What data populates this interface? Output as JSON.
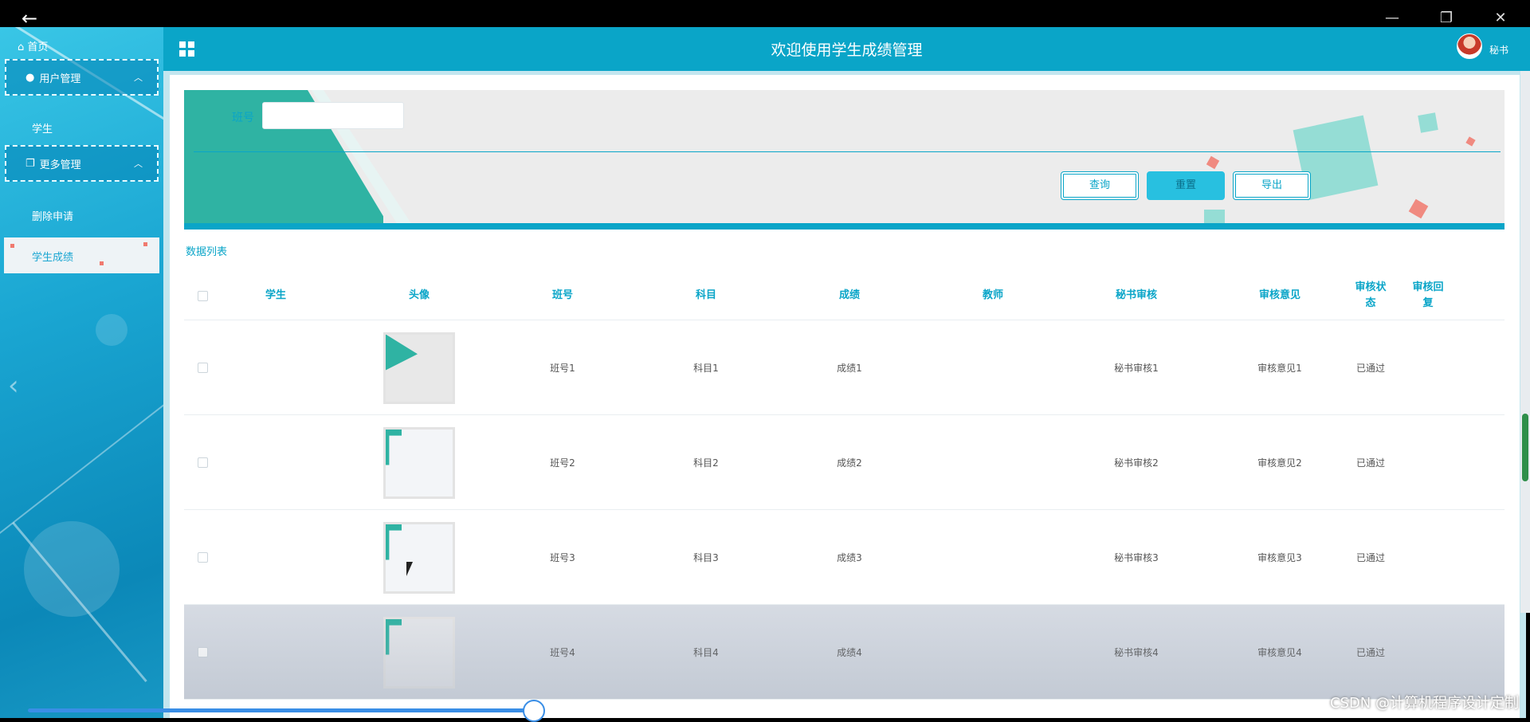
{
  "window": {
    "back_glyph": "←",
    "min_glyph": "—",
    "max_glyph": "❐",
    "close_glyph": "✕"
  },
  "sidebar": {
    "home_label": "首页",
    "groups": [
      {
        "label": "用户管理",
        "items": [
          "学生"
        ]
      },
      {
        "label": "更多管理",
        "items": [
          "删除申请"
        ]
      }
    ],
    "active_item": "学生成绩"
  },
  "header": {
    "title": "欢迎使用学生成绩管理",
    "user": "秘书"
  },
  "search": {
    "field_label": "班号",
    "field_value": "",
    "buttons": {
      "query": "查询",
      "reset": "重置",
      "export": "导出"
    }
  },
  "list_title": "数据列表",
  "table": {
    "columns": [
      "学生",
      "头像",
      "班号",
      "科目",
      "成绩",
      "教师",
      "秘书审核",
      "审核意见",
      "审核状态",
      "审核回复"
    ],
    "rows": [
      {
        "student": "",
        "class": "班号1",
        "subject": "科目1",
        "score": "成绩1",
        "teacher": "",
        "review": "秘书审核1",
        "opinion": "审核意见1",
        "status": "已通过",
        "reply": ""
      },
      {
        "student": "",
        "class": "班号2",
        "subject": "科目2",
        "score": "成绩2",
        "teacher": "",
        "review": "秘书审核2",
        "opinion": "审核意见2",
        "status": "已通过",
        "reply": ""
      },
      {
        "student": "",
        "class": "班号3",
        "subject": "科目3",
        "score": "成绩3",
        "teacher": "",
        "review": "秘书审核3",
        "opinion": "审核意见3",
        "status": "已通过",
        "reply": ""
      },
      {
        "student": "",
        "class": "班号4",
        "subject": "科目4",
        "score": "成绩4",
        "teacher": "",
        "review": "秘书审核4",
        "opinion": "审核意见4",
        "status": "已通过",
        "reply": ""
      }
    ]
  },
  "watermark": "CSDN @计算机程序设计定制",
  "colors": {
    "accent": "#0aa5c8",
    "sidebar": "#1aa6d2",
    "teal": "#2fb3a3"
  }
}
